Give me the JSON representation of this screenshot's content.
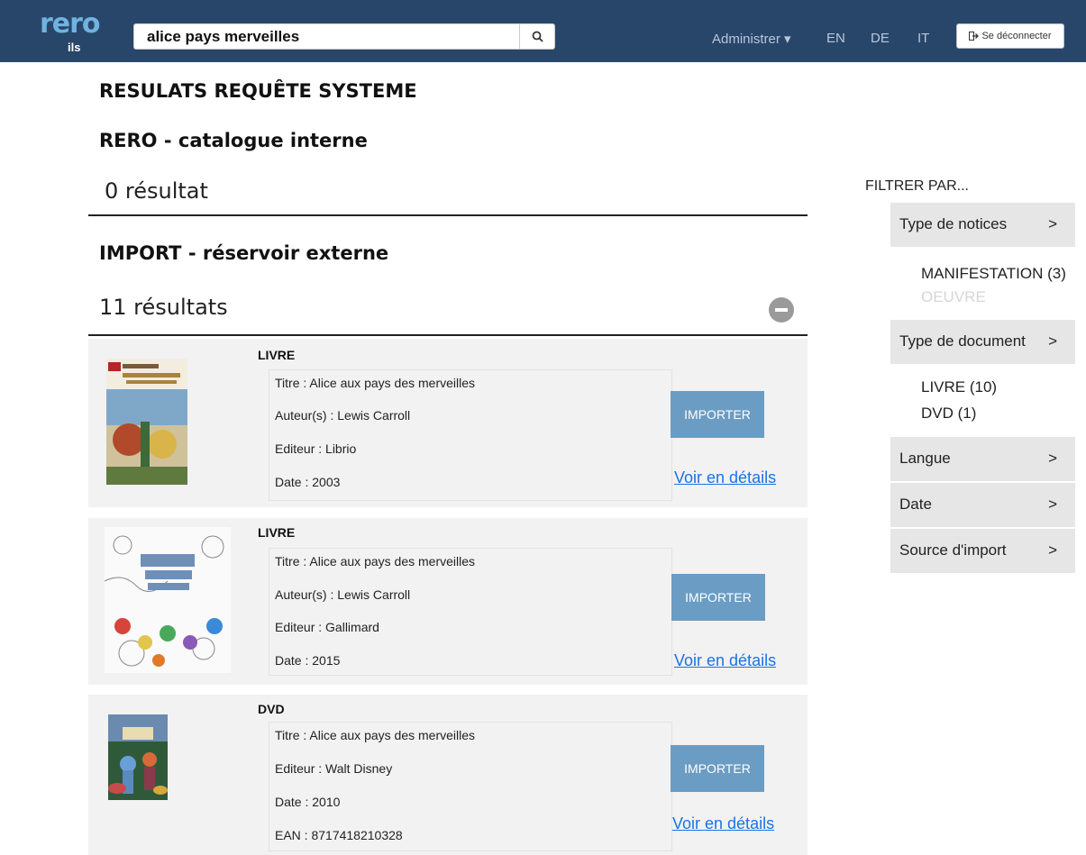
{
  "header": {
    "logo_text": "rero",
    "logo_sub": "ils",
    "search_value": "alice pays merveilles",
    "nav": [
      "Administrer ▾",
      "EN",
      "DE",
      "IT"
    ],
    "logout_label": "Se déconnecter"
  },
  "headings": {
    "main": "RESULATS REQUÊTE SYSTEME",
    "internal": "RERO - catalogue interne",
    "internal_count": "0 résultat",
    "external": "IMPORT - réservoir externe",
    "external_count": "11 résultats"
  },
  "results": [
    {
      "type": "LIVRE",
      "fields": [
        "Titre : Alice aux pays des merveilles",
        "Auteur(s) : Lewis Carroll",
        "Editeur : Librio",
        "Date : 2003"
      ],
      "import_label": "IMPORTER",
      "details_label": "Voir en détails"
    },
    {
      "type": "LIVRE",
      "fields": [
        "Titre : Alice aux pays des merveilles",
        "Auteur(s) : Lewis Carroll",
        "Editeur : Gallimard",
        "Date : 2015"
      ],
      "import_label": "IMPORTER",
      "details_label": "Voir en détails"
    },
    {
      "type": "DVD",
      "fields": [
        "Titre : Alice aux pays des merveilles",
        "Editeur : Walt Disney",
        "Date : 2010",
        "EAN : 8717418210328"
      ],
      "import_label": "IMPORTER",
      "details_label": "Voir en détails"
    }
  ],
  "filters": {
    "title": "FILTRER PAR...",
    "facets": [
      {
        "label": "Type de notices",
        "values": [
          "MANIFESTATION (3)",
          "OEUVRE"
        ]
      },
      {
        "label": "Type de document",
        "values": [
          "LIVRE (10)",
          "DVD (1)"
        ]
      },
      {
        "label": "Langue",
        "values": []
      },
      {
        "label": "Date",
        "values": []
      },
      {
        "label": "Source d'import",
        "values": []
      }
    ]
  }
}
